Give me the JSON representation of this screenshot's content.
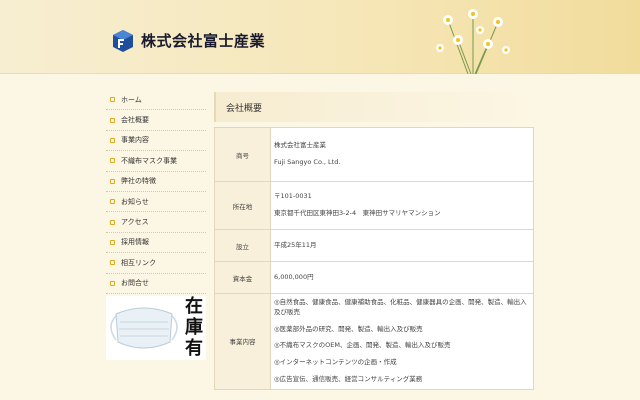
{
  "header": {
    "title": "株式会社富士産業",
    "logo_icon": "fuji-logo-icon",
    "flower_image": "chamomile-flowers-image"
  },
  "nav": {
    "items": [
      {
        "label": "ホーム"
      },
      {
        "label": "会社概要"
      },
      {
        "label": "事業内容"
      },
      {
        "label": "不織布マスク事業"
      },
      {
        "label": "弊社の特徴"
      },
      {
        "label": "お知らせ"
      },
      {
        "label": "アクセス"
      },
      {
        "label": "採用情報"
      },
      {
        "label": "相互リンク"
      },
      {
        "label": "お問合せ"
      }
    ]
  },
  "promo": {
    "text": "在庫有",
    "image": "face-mask-image"
  },
  "content": {
    "heading": "会社概要",
    "rows": {
      "shogo": {
        "label": "商号",
        "lines": [
          "株式会社富士産業",
          "Fuji Sangyo Co., Ltd."
        ]
      },
      "address": {
        "label": "所在地",
        "lines": [
          "〒101-0031",
          "東京都千代田区東神田3-2-4　東神田サマリヤマンション"
        ]
      },
      "established": {
        "label": "設立",
        "lines": [
          "平成25年11月"
        ]
      },
      "capital": {
        "label": "資本金",
        "lines": [
          "6,000,000円"
        ]
      },
      "business": {
        "label": "事業内容",
        "lines": [
          "◎自然食品、健康食品、健康補助食品、化粧品、健康器具の企画、開発、製造、輸出入及び販売",
          "◎医薬部外品の研究、開発、製造、輸出入及び販売",
          "◎不織布マスクのOEM、企画、開発、製造、輸出入及び販売",
          "◎インターネットコンテンツの企画・作成",
          "◎広告宣伝、通信販売、経営コンサルティング業務"
        ]
      }
    }
  },
  "colors": {
    "accent": "#e0a81f",
    "background": "#fcf6e4",
    "label_bg": "#f8f0da"
  }
}
